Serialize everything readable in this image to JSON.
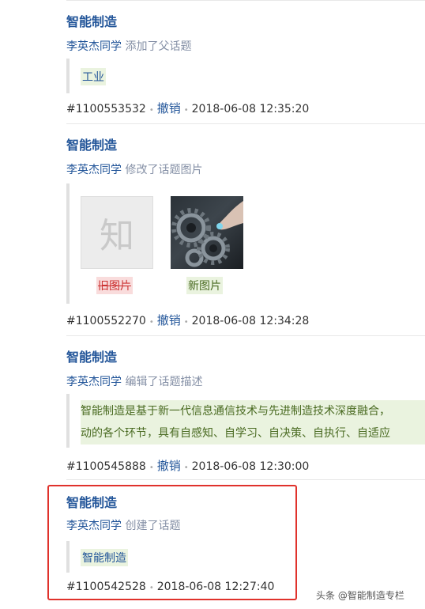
{
  "entries": [
    {
      "topic": "智能制造",
      "user": "李英杰同学",
      "action": "添加了父话题",
      "quote": "工业",
      "id": "#1100553532",
      "undo": "撤销",
      "time": "2018-06-08 12:35:20"
    },
    {
      "topic": "智能制造",
      "user": "李英杰同学",
      "action": "修改了话题图片",
      "old_image_glyph": "知",
      "old_label": "旧图片",
      "new_label": "新图片",
      "id": "#1100552270",
      "undo": "撤销",
      "time": "2018-06-08 12:34:28"
    },
    {
      "topic": "智能制造",
      "user": "李英杰同学",
      "action": "编辑了话题描述",
      "desc_lines": [
        "智能制造是基于新一代信息通信技术与先进制造技术深度融合，",
        "动的各个环节，具有自感知、自学习、自决策、自执行、自适应"
      ],
      "id": "#1100545888",
      "undo": "撤销",
      "time": "2018-06-08 12:30:00"
    },
    {
      "topic": "智能制造",
      "user": "李英杰同学",
      "action": "创建了话题",
      "quote": "智能制造",
      "id": "#1100542528",
      "time": "2018-06-08 12:27:40"
    }
  ],
  "watermark": "头条 @智能制造专栏",
  "colors": {
    "link": "#225599",
    "highlight_border": "#e0322c",
    "added_bg": "#eaf3df",
    "removed_bg": "#f9dcdc"
  }
}
